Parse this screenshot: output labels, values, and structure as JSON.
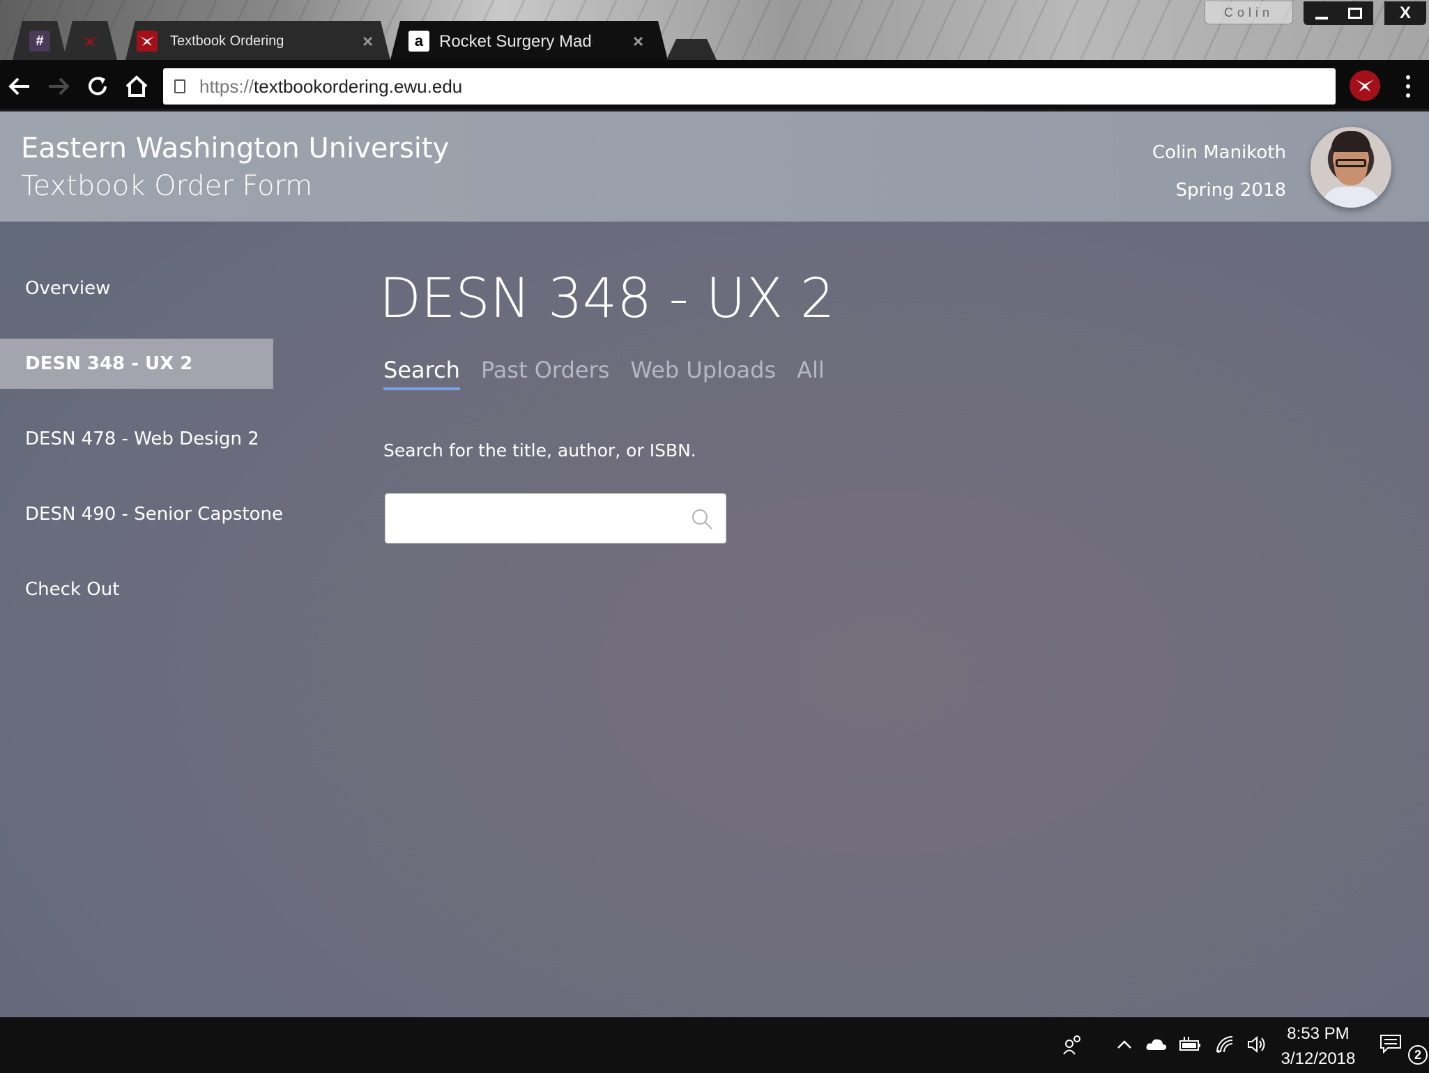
{
  "window": {
    "profile_name": "Colin",
    "close_glyph": "X"
  },
  "tabs": {
    "pinned1_icon": "#",
    "pinned2_icon": "eagle-icon",
    "tab1": {
      "title": "Textbook Ordering",
      "close": "×"
    },
    "tab2": {
      "title": "Rocket Surgery Made Ea",
      "close": "×",
      "favicon": "a"
    }
  },
  "toolbar": {
    "url_scheme": "https://",
    "url_host": "textbookordering.ewu.edu"
  },
  "header": {
    "university": "Eastern Washington University",
    "form_title": "Textbook Order Form",
    "user_name": "Colin Manikoth",
    "term": "Spring 2018"
  },
  "sidebar": {
    "items": [
      {
        "label": "Overview",
        "active": false
      },
      {
        "label": "DESN 348 - UX 2",
        "active": true
      },
      {
        "label": "DESN 478 - Web Design 2",
        "active": false
      },
      {
        "label": "DESN 490 - Senior Capstone",
        "active": false
      },
      {
        "label": "Check Out",
        "active": false
      }
    ]
  },
  "main": {
    "course_title": "DESN 348 - UX 2",
    "tabs": [
      {
        "label": "Search",
        "active": true
      },
      {
        "label": "Past Orders",
        "active": false
      },
      {
        "label": "Web Uploads",
        "active": false
      },
      {
        "label": "All",
        "active": false
      }
    ],
    "search_help": "Search for the title, author, or ISBN.",
    "search_value": "",
    "search_placeholder": ""
  },
  "taskbar": {
    "time": "8:53 PM",
    "date": "3/12/2018",
    "notification_count": "2"
  },
  "colors": {
    "accent_underline": "#7aa2ea",
    "eagle_red": "#a3101a"
  }
}
